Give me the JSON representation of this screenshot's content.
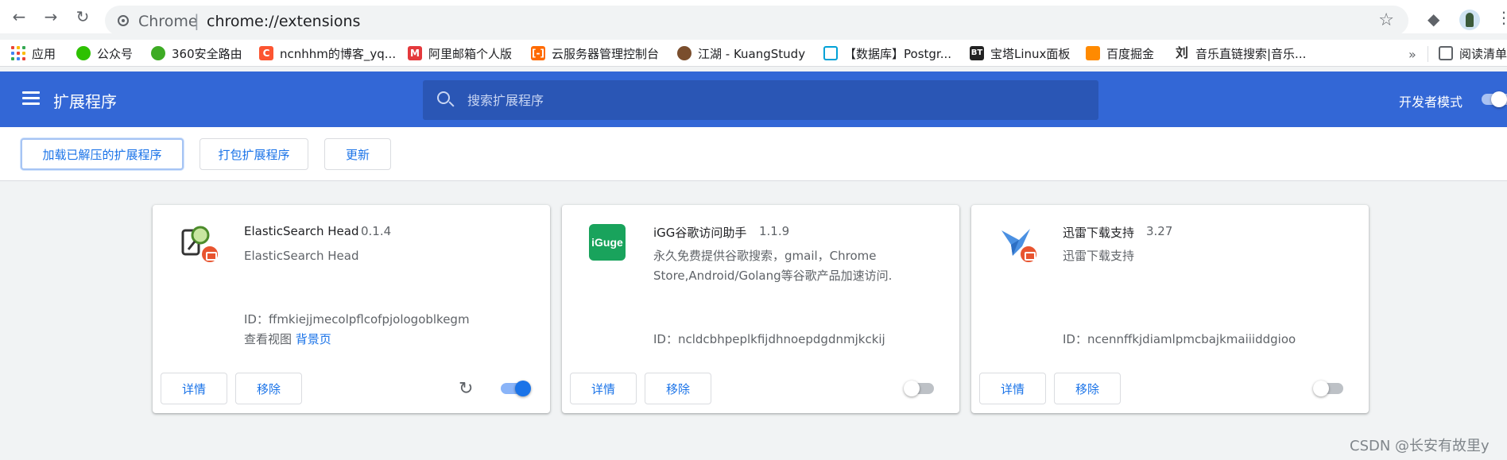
{
  "browser": {
    "omnibox_site": "Chrome",
    "omnibox_separator": "|",
    "omnibox_url": "chrome://extensions",
    "icons": [
      "back-icon",
      "forward-icon",
      "reload-icon",
      "star-icon",
      "extensions-puzzle-icon",
      "kebab-menu-icon"
    ]
  },
  "bookmarks": {
    "items": [
      {
        "label": "应用",
        "icon": "apps-grid-icon"
      },
      {
        "label": "公众号",
        "icon": "wechat-icon",
        "color": "#2dc100"
      },
      {
        "label": "360安全路由",
        "icon": "360-icon",
        "color": "#3dab24"
      },
      {
        "label": "ncnhhm的博客_yq...",
        "icon": "csdn-icon",
        "color": "#fc5531"
      },
      {
        "label": "阿里邮箱个人版",
        "icon": "aliyun-mail-icon",
        "color": "#e4393c"
      },
      {
        "label": "云服务器管理控制台",
        "icon": "aliyun-icon",
        "color": "#ff6a00"
      },
      {
        "label": "江湖 - KuangStudy",
        "icon": "avatar-icon",
        "color": "#7a4e2d"
      },
      {
        "label": "【数据库】Postgr...",
        "icon": "bilibili-icon",
        "color": "#00a1d6"
      },
      {
        "label": "宝塔Linux面板",
        "icon": "bt-icon",
        "color": "#222222"
      },
      {
        "label": "百度掘金",
        "icon": "juejin-icon",
        "color": "#ff8a00"
      },
      {
        "label": "音乐直链搜索|音乐...",
        "icon": "liu-icon",
        "color": "#333333"
      }
    ],
    "more_label": "»",
    "reading_list_label": "阅读清单"
  },
  "header": {
    "title": "扩展程序",
    "search_placeholder": "搜索扩展程序",
    "dev_mode_label": "开发者模式",
    "dev_mode_on": true,
    "accent_color": "#3367d6"
  },
  "dev_toolbar": {
    "load_unpacked": "加载已解压的扩展程序",
    "pack": "打包扩展程序",
    "update": "更新"
  },
  "extensions": [
    {
      "name": "ElasticSearch Head",
      "version": "0.1.4",
      "description": "ElasticSearch Head",
      "id_label": "ID：",
      "id": "ffmkiejjmecolpflcofpjologoblkegm",
      "views_label": "查看视图",
      "views_link": "背景页",
      "details": "详情",
      "remove": "移除",
      "enabled": true
    },
    {
      "name": "iGG谷歌访问助手",
      "version": "1.1.9",
      "description": "永久免费提供谷歌搜索，gmail，Chrome Store,Android/Golang等谷歌产品加速访问.",
      "icon_text": "iGuge",
      "id_label": "ID：",
      "id": "ncldcbhpeplkfijdhnoepdgdnmjkckij",
      "details": "详情",
      "remove": "移除",
      "enabled": false
    },
    {
      "name": "迅雷下载支持",
      "version": "3.27",
      "description": "迅雷下载支持",
      "id_label": "ID：",
      "id": "ncennffkjdiamlpmcbajkmaiiiddgioo",
      "details": "详情",
      "remove": "移除",
      "enabled": false
    }
  ],
  "watermark": "CSDN @长安有故里y"
}
